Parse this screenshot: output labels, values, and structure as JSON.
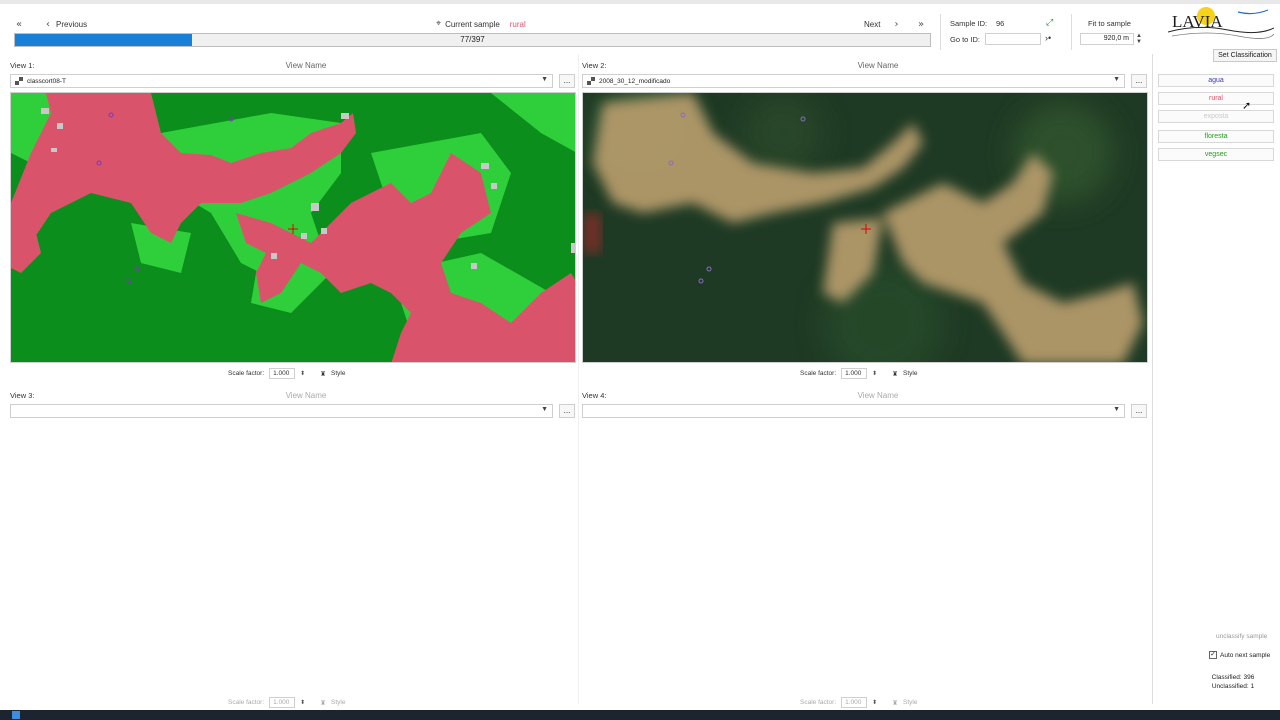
{
  "nav": {
    "first_icon": "double-chevron-left-icon",
    "previous_label": "Previous",
    "current_sample_label": "Current sample",
    "current_sample_class": "rural",
    "next_label": "Next",
    "last_icon": "double-chevron-right-icon"
  },
  "progress": {
    "text": "77/397",
    "fraction": 0.1939
  },
  "sample": {
    "id_label": "Sample ID:",
    "id_value": "96",
    "goto_label": "Go to ID:",
    "goto_value": "",
    "fit_label": "Fit to sample",
    "fit_value": "920,0 m"
  },
  "views": [
    {
      "label": "View 1:",
      "name_label": "View Name",
      "layer": "classcort08-T",
      "scale_label": "Scale factor:",
      "scale_value": "1.000",
      "style_label": "Style"
    },
    {
      "label": "View 2:",
      "name_label": "View Name",
      "layer": "2008_30_12_modificado",
      "scale_label": "Scale factor:",
      "scale_value": "1.000",
      "style_label": "Style"
    },
    {
      "label": "View 3:",
      "name_label": "View Name",
      "layer": "",
      "scale_label": "Scale factor:",
      "scale_value": "1.000",
      "style_label": "Style"
    },
    {
      "label": "View 4:",
      "name_label": "View Name",
      "layer": "",
      "scale_label": "Scale factor:",
      "scale_value": "1.000",
      "style_label": "Style"
    }
  ],
  "more_button": "...",
  "logo_text": "LAVIA",
  "classification": {
    "set_label": "Set Classification",
    "classes": [
      {
        "label": "agua",
        "color": "#3b3bb3"
      },
      {
        "label": "rural",
        "color": "#d9536b"
      },
      {
        "label": "exposta",
        "color": "#c9c9c9"
      },
      {
        "label": "floresta",
        "color": "#22a022"
      },
      {
        "label": "vegsec",
        "color": "#22a022"
      }
    ],
    "unclassify_label": "unclassify sample",
    "auto_next_label": "Auto next sample",
    "auto_next_checked": true,
    "classified_text": "Classified: 396",
    "unclassified_text": "Unclassified: 1"
  },
  "colors": {
    "progress": "#1a7fd6",
    "green": "#0b8e1c",
    "light_green": "#2fcf3b",
    "rural_pink": "#d9536b"
  }
}
